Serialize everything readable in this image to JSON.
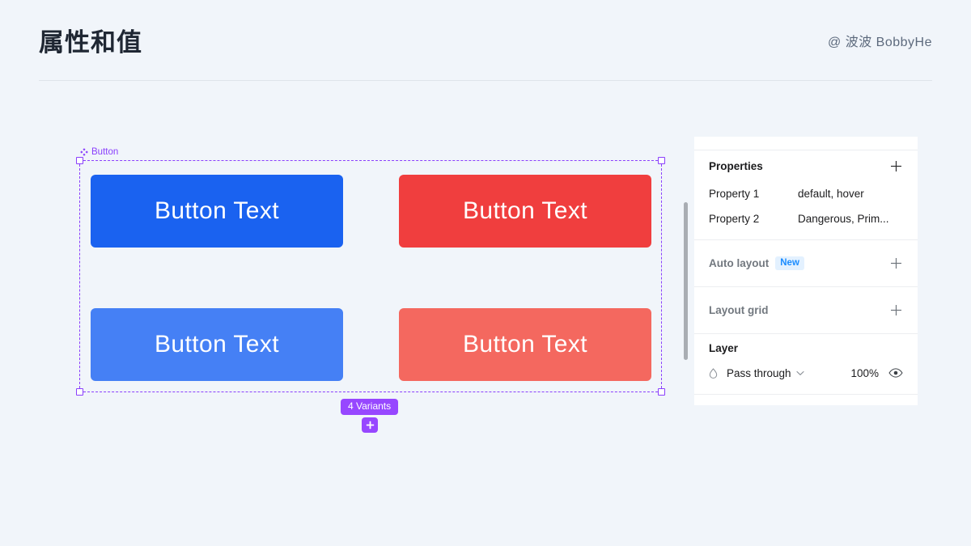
{
  "header": {
    "title": "属性和值",
    "author": "@ 波波 BobbyHe"
  },
  "canvas": {
    "selection_label": "Button",
    "component_icon": "component-diamond-icon",
    "variants_badge": "4 Variants",
    "add_variant_icon": "plus-icon",
    "buttons": [
      {
        "label": "Button Text",
        "color": "#1a62f0",
        "variant": "Primary default"
      },
      {
        "label": "Button Text",
        "color": "#f03e3e",
        "variant": "Dangerous default"
      },
      {
        "label": "Button Text",
        "color": "#4580f5",
        "variant": "Primary hover"
      },
      {
        "label": "Button Text",
        "color": "#f4685f",
        "variant": "Dangerous hover"
      }
    ]
  },
  "panel": {
    "properties": {
      "title": "Properties",
      "add_icon": "plus-icon",
      "rows": [
        {
          "name": "Property 1",
          "value": "default, hover"
        },
        {
          "name": "Property 2",
          "value": "Dangerous, Prim..."
        }
      ]
    },
    "auto_layout": {
      "title": "Auto layout",
      "badge": "New",
      "add_icon": "plus-icon"
    },
    "layout_grid": {
      "title": "Layout grid",
      "add_icon": "plus-icon"
    },
    "layer": {
      "title": "Layer",
      "blend_icon": "blend-mode-drop-icon",
      "blend_mode": "Pass through",
      "chevron_icon": "chevron-down-icon",
      "opacity": "100%",
      "visibility_icon": "eye-icon"
    }
  },
  "colors": {
    "page_background": "#f1f5fa",
    "panel_background": "#ffffff",
    "selection_purple": "#8a3ffc",
    "variant_purple": "#9747ff",
    "badge_blue": "#1a8cff"
  }
}
